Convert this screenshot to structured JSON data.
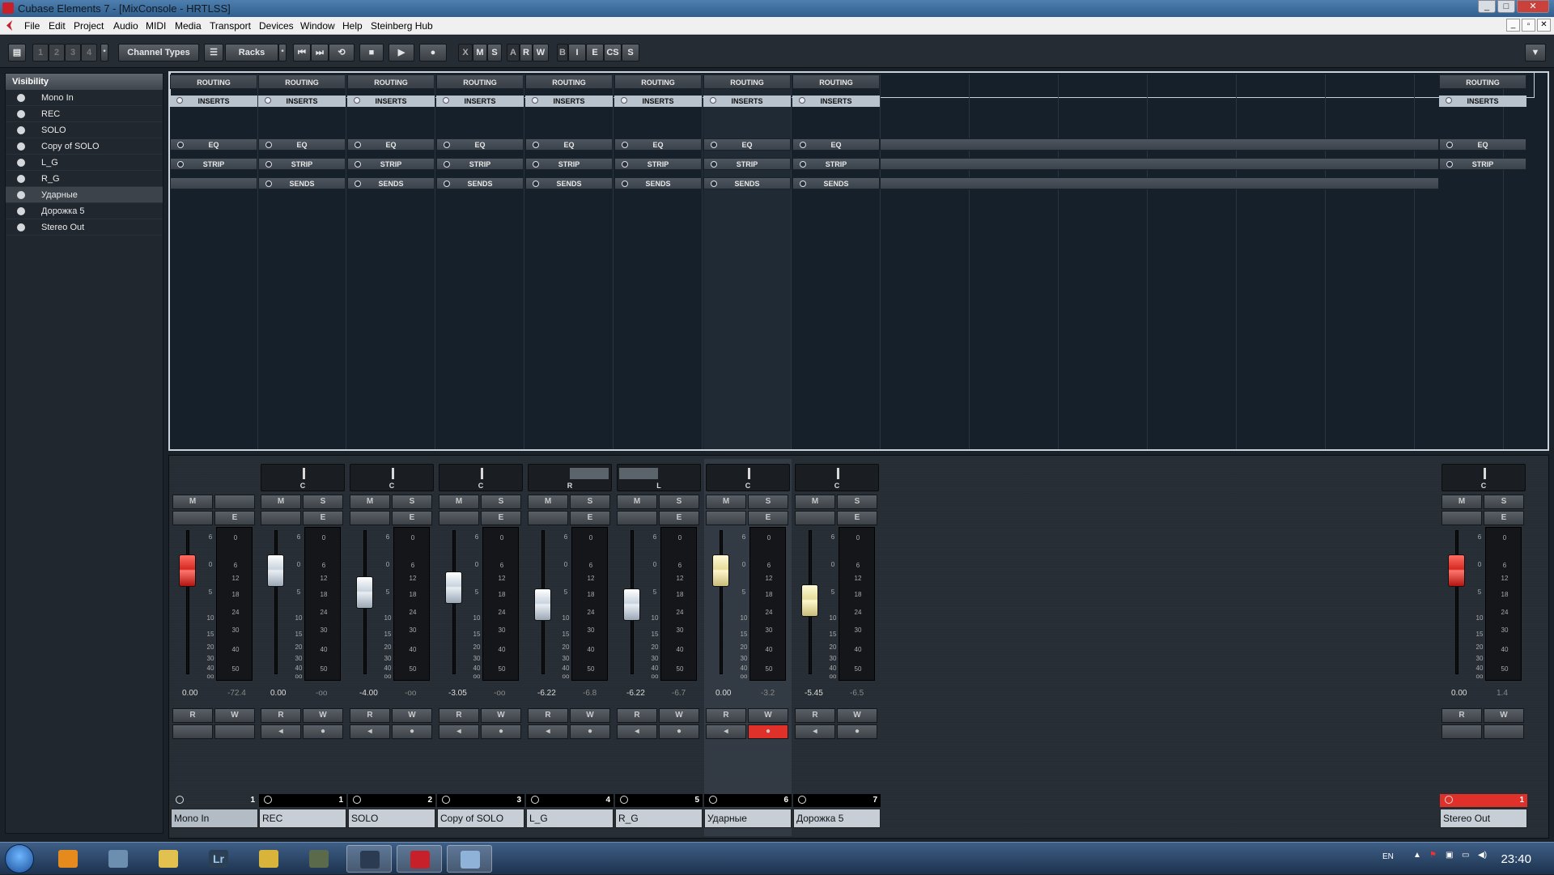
{
  "window": {
    "title": "Cubase Elements 7 - [MixConsole - HRTLSS]",
    "controls": [
      "_",
      "□",
      "✕"
    ],
    "mdi_controls": [
      "_",
      "▫",
      "✕"
    ]
  },
  "menu": [
    "File",
    "Edit",
    "Project",
    "Audio",
    "MIDI",
    "Media",
    "Transport",
    "Devices",
    "Window",
    "Help",
    "Steinberg Hub"
  ],
  "toolbar": {
    "pages": [
      "1",
      "2",
      "3",
      "4"
    ],
    "channel_types": "Channel Types",
    "racks": "Racks",
    "mute_solo": [
      "X",
      "M",
      "S"
    ],
    "rw": [
      "A",
      "R",
      "W"
    ],
    "other": [
      "B",
      "I",
      "E",
      "CS",
      "S"
    ],
    "expand": "▼"
  },
  "visibility": {
    "header": "Visibility",
    "items": [
      "Mono In",
      "REC",
      "SOLO",
      "Copy of SOLO",
      "L_G",
      "R_G",
      "Ударные",
      "Дорожка 5",
      "Stereo Out"
    ],
    "selected_index": 6
  },
  "racks": {
    "routing": "ROUTING",
    "inserts": "INSERTS",
    "eq": "EQ",
    "strip": "STRIP",
    "sends": "SENDS"
  },
  "buttons": {
    "m": "M",
    "s": "S",
    "e": "E",
    "r": "R",
    "w": "W",
    "listen": "◂",
    "rec": "●"
  },
  "meter_scale": [
    "0",
    "6",
    "12",
    "18",
    "24",
    "30",
    "40",
    "50"
  ],
  "fader_scale": [
    "6",
    "0",
    "5",
    "10",
    "15",
    "20",
    "30",
    "40",
    "oo"
  ],
  "channels": [
    {
      "name": "Mono In",
      "num": "1",
      "volume": "0.00",
      "peak": "-72.4",
      "pan": "",
      "fader_color": "red",
      "fader_db": 0,
      "type": "input"
    },
    {
      "name": "REC",
      "num": "1",
      "volume": "0.00",
      "peak": "-oo",
      "pan": "C",
      "fader_color": "white",
      "fader_db": 0,
      "rec": false
    },
    {
      "name": "SOLO",
      "num": "2",
      "volume": "-4.00",
      "peak": "-oo",
      "pan": "C",
      "fader_color": "white",
      "fader_db": -4,
      "rec": false
    },
    {
      "name": "Copy of SOLO",
      "num": "3",
      "volume": "-3.05",
      "peak": "-oo",
      "pan": "C",
      "fader_color": "white",
      "fader_db": -3.05,
      "rec": false
    },
    {
      "name": "L_G",
      "num": "4",
      "volume": "-6.22",
      "peak": "-6.8",
      "pan": "R",
      "fader_color": "white",
      "fader_db": -6.22,
      "rec": false
    },
    {
      "name": "R_G",
      "num": "5",
      "volume": "-6.22",
      "peak": "-6.7",
      "pan": "L",
      "fader_color": "white",
      "fader_db": -6.22,
      "rec": false
    },
    {
      "name": "Ударные",
      "num": "6",
      "volume": "0.00",
      "peak": "-3.2",
      "pan": "C",
      "fader_color": "cream",
      "fader_db": 0,
      "rec": true
    },
    {
      "name": "Дорожка 5",
      "num": "7",
      "volume": "-5.45",
      "peak": "-6.5",
      "pan": "C",
      "fader_color": "cream",
      "fader_db": -5.45,
      "rec": false
    },
    {
      "name": "Stereo Out",
      "num": "1",
      "volume": "0.00",
      "peak": "1.4",
      "pan": "C",
      "fader_color": "red",
      "fader_db": 0,
      "type": "output"
    }
  ],
  "taskbar": {
    "language": "EN",
    "clock": "23:40",
    "apps": [
      "media-player",
      "computer",
      "folder",
      "lightroom",
      "chrome",
      "game",
      "steam",
      "cubase",
      "window"
    ],
    "lightroom_label": "Lr"
  },
  "colors": {
    "accent_red": "#e0302a",
    "rack_bg": "#16202b",
    "strip_bg": "#2a3037"
  }
}
